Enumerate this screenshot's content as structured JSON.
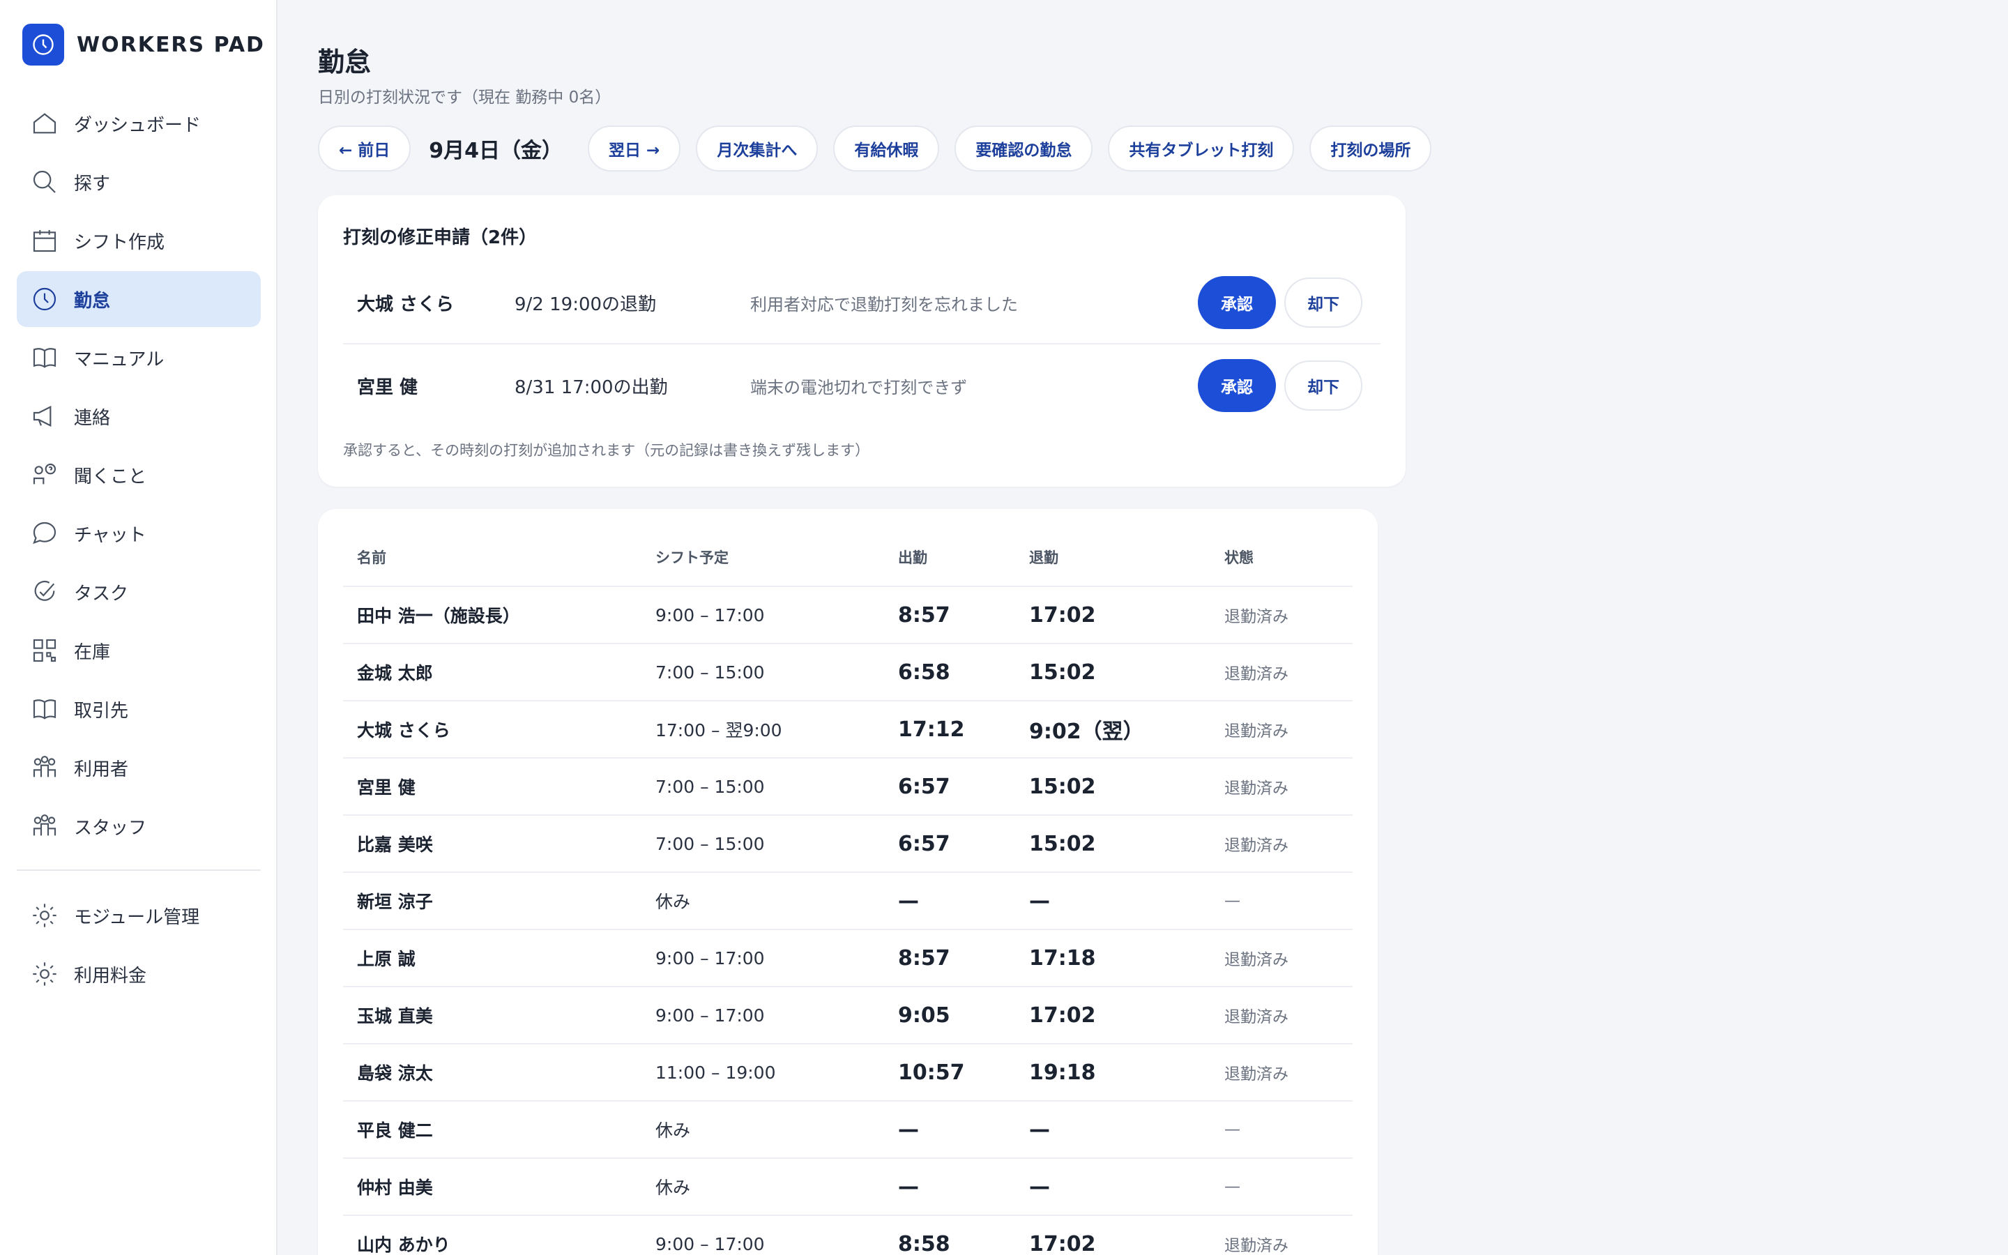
{
  "brand": {
    "name": "WORKERS PAD",
    "icon": "clock-icon",
    "color": "#1d4ed8"
  },
  "sidebar": {
    "items": [
      {
        "label": "ダッシュボード",
        "icon": "home-icon"
      },
      {
        "label": "探す",
        "icon": "search-icon"
      },
      {
        "label": "シフト作成",
        "icon": "calendar-icon"
      },
      {
        "label": "勤怠",
        "icon": "clock-icon",
        "active": true
      },
      {
        "label": "マニュアル",
        "icon": "book-icon"
      },
      {
        "label": "連絡",
        "icon": "megaphone-icon"
      },
      {
        "label": "聞くこと",
        "icon": "question-people-icon"
      },
      {
        "label": "チャット",
        "icon": "chat-bubble-icon"
      },
      {
        "label": "タスク",
        "icon": "check-circle-icon"
      },
      {
        "label": "在庫",
        "icon": "qr-code-icon"
      },
      {
        "label": "取引先",
        "icon": "book-icon"
      },
      {
        "label": "利用者",
        "icon": "people-icon"
      },
      {
        "label": "スタッフ",
        "icon": "people-icon"
      }
    ],
    "bottom_items": [
      {
        "label": "モジュール管理",
        "icon": "gear-icon"
      },
      {
        "label": "利用料金",
        "icon": "gear-icon"
      }
    ]
  },
  "page": {
    "title": "勤怠",
    "subtitle": "日別の打刻状況です（現在 勤務中 0名）"
  },
  "toolbar": {
    "prev_label": "← 前日",
    "date_label": "9月4日（金）",
    "next_label": "翌日 →",
    "monthly_label": "月次集計へ",
    "paid_leave_label": "有給休暇",
    "review_label": "要確認の勤怠",
    "tablet_label": "共有タブレット打刻",
    "location_label": "打刻の場所"
  },
  "requests": {
    "title": "打刻の修正申請（2件）",
    "items": [
      {
        "name": "大城 さくら",
        "time": "9/2 19:00の退勤",
        "reason": "利用者対応で退勤打刻を忘れました",
        "approve": "承認",
        "reject": "却下"
      },
      {
        "name": "宮里 健",
        "time": "8/31 17:00の出勤",
        "reason": "端末の電池切れで打刻できず",
        "approve": "承認",
        "reject": "却下"
      }
    ],
    "note": "承認すると、その時刻の打刻が追加されます（元の記録は書き換えず残します）"
  },
  "table": {
    "headers": {
      "name": "名前",
      "shift": "シフト予定",
      "in": "出勤",
      "out": "退勤",
      "status": "状態"
    },
    "rows": [
      {
        "name": "田中 浩一（施設長）",
        "shift": "9:00 – 17:00",
        "in": "8:57",
        "out": "17:02",
        "status": "退勤済み"
      },
      {
        "name": "金城 太郎",
        "shift": "7:00 – 15:00",
        "in": "6:58",
        "out": "15:02",
        "status": "退勤済み"
      },
      {
        "name": "大城 さくら",
        "shift": "17:00 – 翌9:00",
        "in": "17:12",
        "out": "9:02（翌）",
        "status": "退勤済み"
      },
      {
        "name": "宮里 健",
        "shift": "7:00 – 15:00",
        "in": "6:57",
        "out": "15:02",
        "status": "退勤済み"
      },
      {
        "name": "比嘉 美咲",
        "shift": "7:00 – 15:00",
        "in": "6:57",
        "out": "15:02",
        "status": "退勤済み"
      },
      {
        "name": "新垣 涼子",
        "shift": "休み",
        "in": "—",
        "out": "—",
        "status": "—"
      },
      {
        "name": "上原 誠",
        "shift": "9:00 – 17:00",
        "in": "8:57",
        "out": "17:18",
        "status": "退勤済み"
      },
      {
        "name": "玉城 直美",
        "shift": "9:00 – 17:00",
        "in": "9:05",
        "out": "17:02",
        "status": "退勤済み"
      },
      {
        "name": "島袋 涼太",
        "shift": "11:00 – 19:00",
        "in": "10:57",
        "out": "19:18",
        "status": "退勤済み"
      },
      {
        "name": "平良 健二",
        "shift": "休み",
        "in": "—",
        "out": "—",
        "status": "—"
      },
      {
        "name": "仲村 由美",
        "shift": "休み",
        "in": "—",
        "out": "—",
        "status": "—"
      },
      {
        "name": "山内 あかり",
        "shift": "9:00 – 17:00",
        "in": "8:58",
        "out": "17:02",
        "status": "退勤済み"
      }
    ]
  }
}
